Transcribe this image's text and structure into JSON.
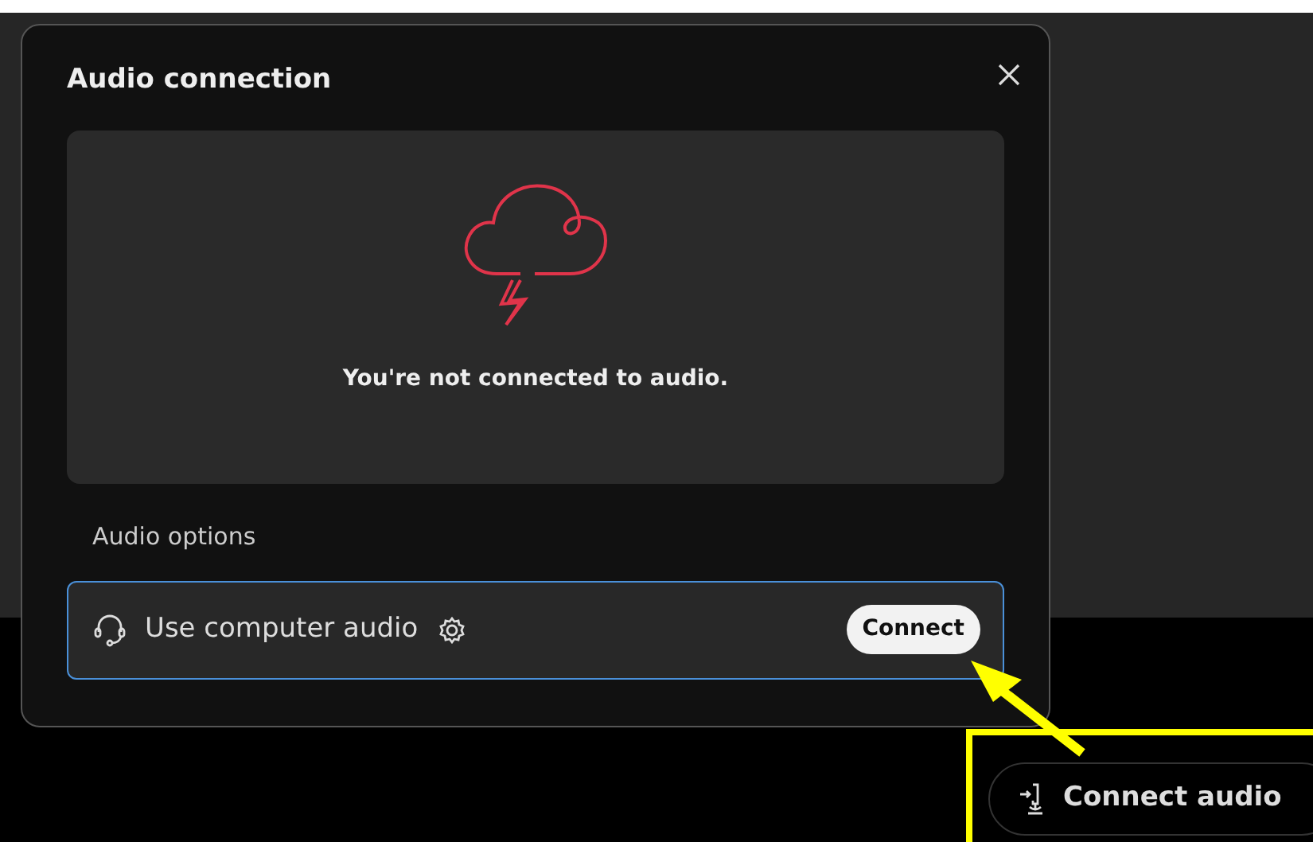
{
  "dialog": {
    "title": "Audio connection",
    "message": "You're not connected to audio.",
    "section_label": "Audio options",
    "options": [
      {
        "label": "Use computer audio",
        "button": "Connect",
        "selected": true
      }
    ]
  },
  "toolbar": {
    "connect_button": "Connect audio"
  }
}
